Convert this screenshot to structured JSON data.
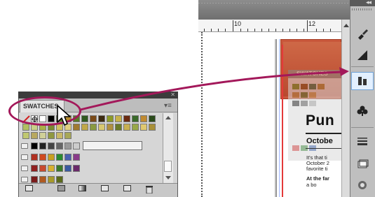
{
  "swatches_panel": {
    "tab_label": "SWATCHES",
    "menu_icon": "panel-menu-icon",
    "scroll": {
      "up_icon": "scroll-up-icon",
      "down_icon": "scroll-down-icon"
    },
    "bottom_icons": [
      "show-all-swatches-icon",
      "show-color-swatches-icon",
      "show-gradient-swatches-icon",
      "new-color-group-icon",
      "new-swatch-icon",
      "delete-swatch-icon"
    ]
  },
  "document": {
    "ruler_numbers": [
      "10",
      "12"
    ],
    "heading": "Pun",
    "subheading": "Octobe",
    "body_lines": "It's that ti\nOctober 2\nfavorite ti",
    "body2": "At the far",
    "body3": "a bo"
  },
  "ghost_panel": {
    "tab_label": "SWATCHES"
  },
  "dock": {
    "items": [
      "paintbrush-icon",
      "gradient-icon",
      "swatches-dock-icon",
      "club-icon",
      "stroke-icon",
      "layers-icon",
      "color-icon"
    ]
  },
  "colors": {
    "highlight": "#a3185a",
    "doc_block": "#c9583c",
    "margin": "#e43a3a"
  }
}
